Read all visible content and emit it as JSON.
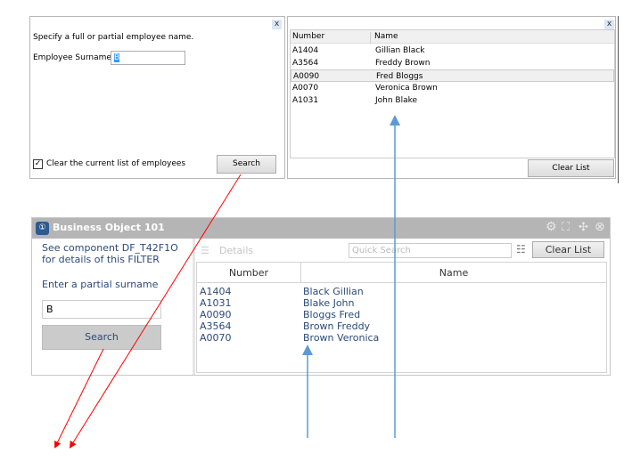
{
  "dialog": {
    "close": "x",
    "instruction": "Specify a full or partial employee name.",
    "surname_label": "Employee Surname",
    "surname_value": "B",
    "clear_checkbox_label": "Clear the current list of employees",
    "clear_checked": true,
    "search_label": "Search"
  },
  "list_panel": {
    "close": "x",
    "columns": [
      "Number",
      "Name"
    ],
    "rows": [
      {
        "number": "A1404",
        "name": "Gillian Black"
      },
      {
        "number": "A3564",
        "name": "Freddy Brown"
      },
      {
        "number": "A0090",
        "name": "Fred Bloggs"
      },
      {
        "number": "A0070",
        "name": "Veronica Brown"
      },
      {
        "number": "A1031",
        "name": "John Blake"
      }
    ],
    "selected_row": 2,
    "clear_label": "Clear List"
  },
  "bo": {
    "title": "Business Object 101",
    "icons": [
      "settings-icon",
      "collapse-icon",
      "expand-icon",
      "close-icon"
    ],
    "filter_note_1": "See component DF_T42F1O",
    "filter_note_2": "for details of this FILTER",
    "surname_label": "Enter a partial surname",
    "surname_value": "B",
    "search_label": "Search",
    "details_label": "Details",
    "quick_search_placeholder": "Quick Search",
    "clear_label": "Clear List",
    "columns": [
      "Number",
      "Name"
    ],
    "rows": [
      {
        "number": "A1404",
        "name": "Black Gillian"
      },
      {
        "number": "A1031",
        "name": "Blake John"
      },
      {
        "number": "A0090",
        "name": "Bloggs Fred"
      },
      {
        "number": "A3564",
        "name": "Brown Freddy"
      },
      {
        "number": "A0070",
        "name": "Brown Veronica"
      }
    ]
  },
  "colors": {
    "title_bar": "#b5b5b5",
    "text_blue": "#2b4a78",
    "arrow_red": "#ff0000",
    "arrow_blue": "#5b9bd5"
  }
}
